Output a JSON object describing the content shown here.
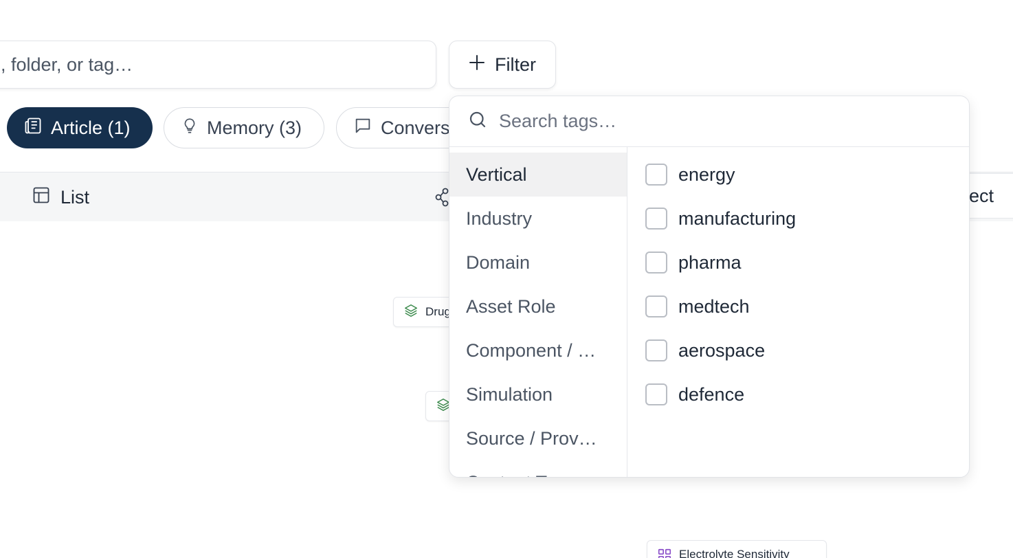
{
  "search": {
    "placeholder": ", folder, or tag…"
  },
  "filter": {
    "label": "Filter"
  },
  "chips": [
    {
      "label": "Article (1)"
    },
    {
      "label": "Memory (3)"
    },
    {
      "label": "Convers"
    }
  ],
  "views": {
    "list_label": "List",
    "project_label": "oject"
  },
  "nodes": [
    {
      "label": "Drug"
    },
    {
      "label": ""
    },
    {
      "label": "Electrolyte Sensitivity"
    }
  ],
  "tag_dropdown": {
    "search_placeholder": "Search tags…",
    "categories": [
      {
        "label": "Vertical"
      },
      {
        "label": "Industry"
      },
      {
        "label": "Domain"
      },
      {
        "label": "Asset Role"
      },
      {
        "label": "Component / …"
      },
      {
        "label": "Simulation"
      },
      {
        "label": "Source / Prov…"
      },
      {
        "label": "Content Ty…"
      }
    ],
    "selected_category": "Vertical",
    "tags": [
      {
        "label": "energy",
        "checked": false
      },
      {
        "label": "manufacturing",
        "checked": false
      },
      {
        "label": "pharma",
        "checked": false
      },
      {
        "label": "medtech",
        "checked": false
      },
      {
        "label": "aerospace",
        "checked": false
      },
      {
        "label": "defence",
        "checked": false
      }
    ]
  },
  "colors": {
    "active_chip": "#16304d",
    "node_stack_icon": "#3b8a4c",
    "node_grid_icon": "#8b4fc9"
  }
}
